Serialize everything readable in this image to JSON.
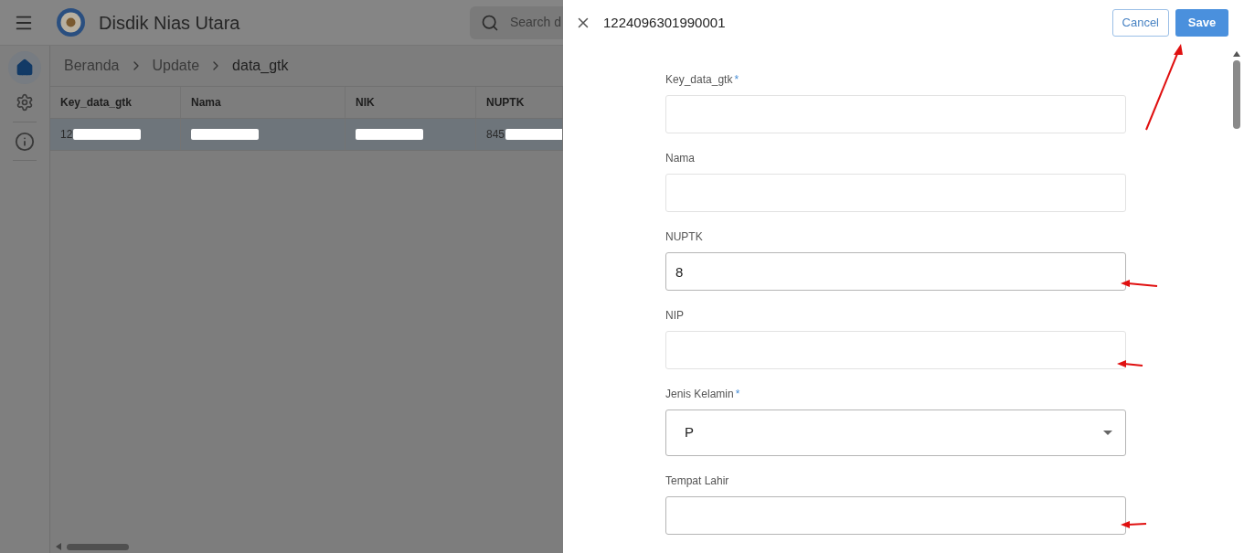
{
  "app": {
    "title": "Disdik Nias Utara",
    "search_placeholder": "Search d"
  },
  "breadcrumb": [
    "Beranda",
    "Update",
    "data_gtk"
  ],
  "table": {
    "columns": [
      "Key_data_gtk",
      "Nama",
      "NIK",
      "NUPTK"
    ],
    "rows": [
      {
        "selected": true,
        "cells": [
          {
            "text": "12",
            "redacted": true
          },
          {
            "redacted": true
          },
          {
            "redacted": true
          },
          {
            "text": "845",
            "redacted": true
          }
        ]
      }
    ]
  },
  "drawer": {
    "title": "1224096301990001",
    "cancel": "Cancel",
    "save": "Save"
  },
  "fields": [
    {
      "kind": "text",
      "label": "Key_data_gtk",
      "required_mark": "*",
      "disabled": true
    },
    {
      "kind": "text",
      "label": "Nama",
      "disabled": true
    },
    {
      "kind": "text",
      "label": "NUPTK",
      "disabled": false,
      "value": "8"
    },
    {
      "kind": "text",
      "label": "NIP",
      "disabled": true
    },
    {
      "kind": "select",
      "label": "Jenis Kelamin",
      "required_mark": "*",
      "disabled": false,
      "value": "P"
    },
    {
      "kind": "text",
      "label": "Tempat Lahir",
      "disabled": false
    }
  ]
}
